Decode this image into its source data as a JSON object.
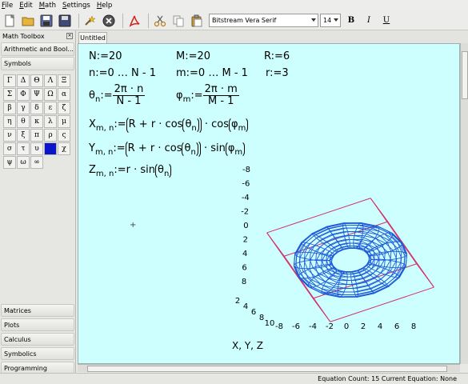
{
  "menu": [
    "File",
    "Edit",
    "Math",
    "Settings",
    "Help"
  ],
  "toolbar": {
    "font_name": "Bitstream Vera Serif",
    "font_size": "14",
    "bold": "B",
    "italic": "I",
    "underline": "U"
  },
  "sidebar": {
    "title": "Math Toolbox",
    "sections_top": [
      "Arithmetic and Bool...",
      "Symbols"
    ],
    "symbols": [
      "Γ",
      "Δ",
      "Θ",
      "Λ",
      "Ξ",
      "Σ",
      "Φ",
      "Ψ",
      "Ω",
      "α",
      "β",
      "γ",
      "δ",
      "ε",
      "ζ",
      "η",
      "θ",
      "κ",
      "λ",
      "μ",
      "ν",
      "ξ",
      "π",
      "ρ",
      "ς",
      "σ",
      "τ",
      "υ",
      "",
      "χ",
      "ψ",
      "ω",
      "∞"
    ],
    "selected_symbol_index": 28,
    "sections_bottom": [
      "Matrices",
      "Plots",
      "Calculus",
      "Symbolics",
      "Programming"
    ]
  },
  "document_tab": "Untitled",
  "equations": {
    "N": "N:=20",
    "M": "M:=20",
    "R": "R:=6",
    "n_range": "n:=0 … N - 1",
    "m_range": "m:=0 … M - 1",
    "r": "r:=3",
    "theta_lhs": "θ",
    "theta_sub": "n",
    "theta_num": "2π · n",
    "theta_den": "N - 1",
    "phi_lhs": "φ",
    "phi_sub": "m",
    "phi_num": "2π · m",
    "phi_den": "M - 1",
    "x_lhs": "X",
    "y_lhs": "Y",
    "z_lhs": "Z",
    "mn_sub": "m, n",
    "assign": ":=",
    "inner": "R + r · cos",
    "theta_arg": "θ",
    "n_sub": "n",
    "dot_cos": "· cos",
    "dot_sin": "· sin",
    "phi_arg": "φ",
    "m_sub": "m",
    "z_rhs": "r · sin"
  },
  "plot": {
    "caption": "X, Y, Z",
    "y_ticks": [
      "-8",
      "-6",
      "-4",
      "-2",
      "0",
      "2",
      "4",
      "6",
      "8"
    ],
    "x_ticks": [
      "-8",
      "-6",
      "-4",
      "-2",
      "0",
      "2",
      "4",
      "6",
      "8"
    ],
    "z_ticks": [
      "2",
      "4",
      "6",
      "8",
      "10"
    ],
    "colors": {
      "surface": "#1e5ad8",
      "box": "#d0306a"
    }
  },
  "status": "Equation Count: 15  Current Equation: None"
}
